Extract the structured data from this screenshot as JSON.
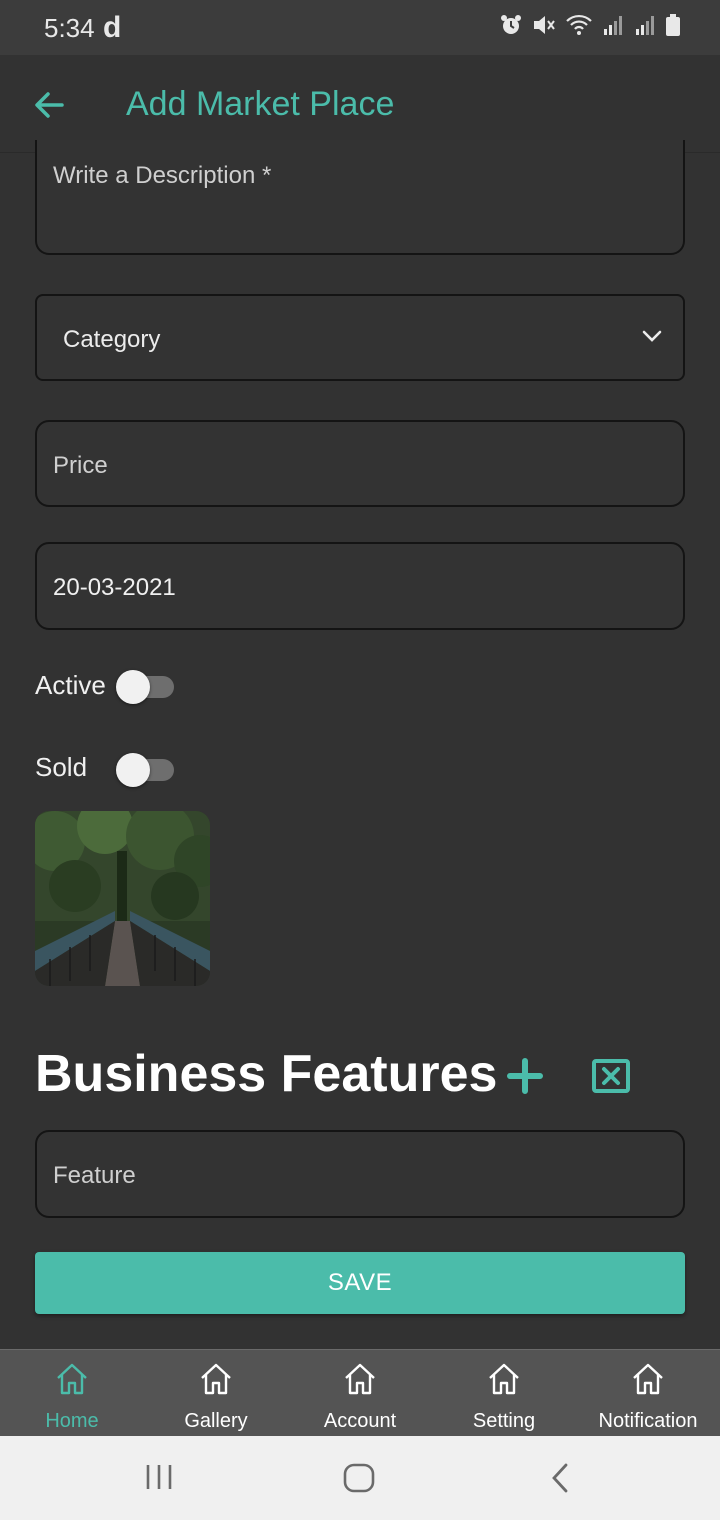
{
  "status_bar": {
    "time": "5:34",
    "carrier_glyph": "d",
    "icons": [
      "alarm-icon",
      "mute-icon",
      "wifi-icon",
      "signal-icon",
      "signal-icon",
      "battery-icon"
    ]
  },
  "app_bar": {
    "title": "Add Market Place",
    "back_icon": "arrow-back-icon"
  },
  "form": {
    "description_placeholder": "Write a Description *",
    "category_value": "Category",
    "price_placeholder": "Price",
    "date_value": "20-03-2021",
    "active_label": "Active",
    "active_on": false,
    "sold_label": "Sold",
    "sold_on": false
  },
  "features": {
    "title": "Business Features",
    "add_icon": "plus-icon",
    "clear_icon": "close-box-icon",
    "feature_placeholder": "Feature"
  },
  "save_label": "SAVE",
  "bottom_nav": {
    "items": [
      {
        "label": "Home",
        "icon": "home-icon",
        "active": true
      },
      {
        "label": "Gallery",
        "icon": "home-icon",
        "active": false
      },
      {
        "label": "Account",
        "icon": "home-icon",
        "active": false
      },
      {
        "label": "Setting",
        "icon": "home-icon",
        "active": false
      },
      {
        "label": "Notification",
        "icon": "home-icon",
        "active": false
      }
    ]
  },
  "colors": {
    "accent": "#4bbcaa",
    "background": "#323232",
    "nav_background": "#545454"
  }
}
